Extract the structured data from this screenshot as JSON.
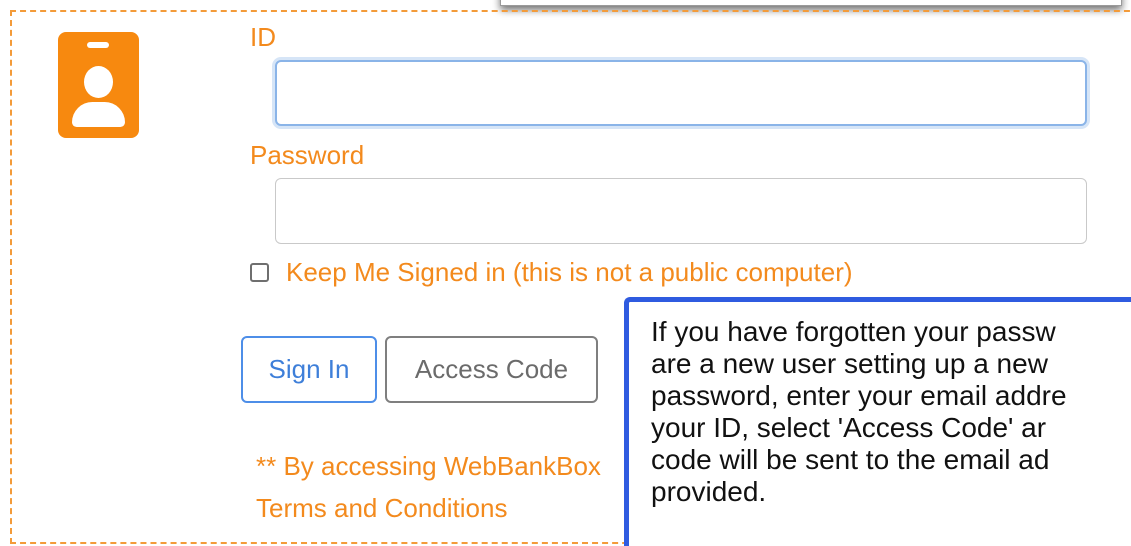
{
  "form": {
    "id_label": "ID",
    "id_value": "",
    "password_label": "Password",
    "password_value": "",
    "keep_signed_in_label": "Keep Me Signed in (this is not a public computer)",
    "keep_signed_in_checked": false,
    "sign_in_label": "Sign In",
    "access_code_label": "Access Code",
    "disclaimer_text": "** By accessing WebBankBox",
    "terms_link_text": "Terms and Conditions"
  },
  "tooltip": {
    "lines": [
      "If you have forgotten your passw",
      "are a new user setting up a new",
      "password, enter your email addre",
      "your ID, select 'Access Code' ar",
      "code will be sent to the email ad",
      "provided."
    ]
  },
  "colors": {
    "accent_orange": "#f38a1d",
    "badge_orange": "#f7890f",
    "primary_blue": "#3e7fd9",
    "tooltip_border": "#2f5be0"
  },
  "icons": {
    "badge": "id-badge-icon"
  }
}
